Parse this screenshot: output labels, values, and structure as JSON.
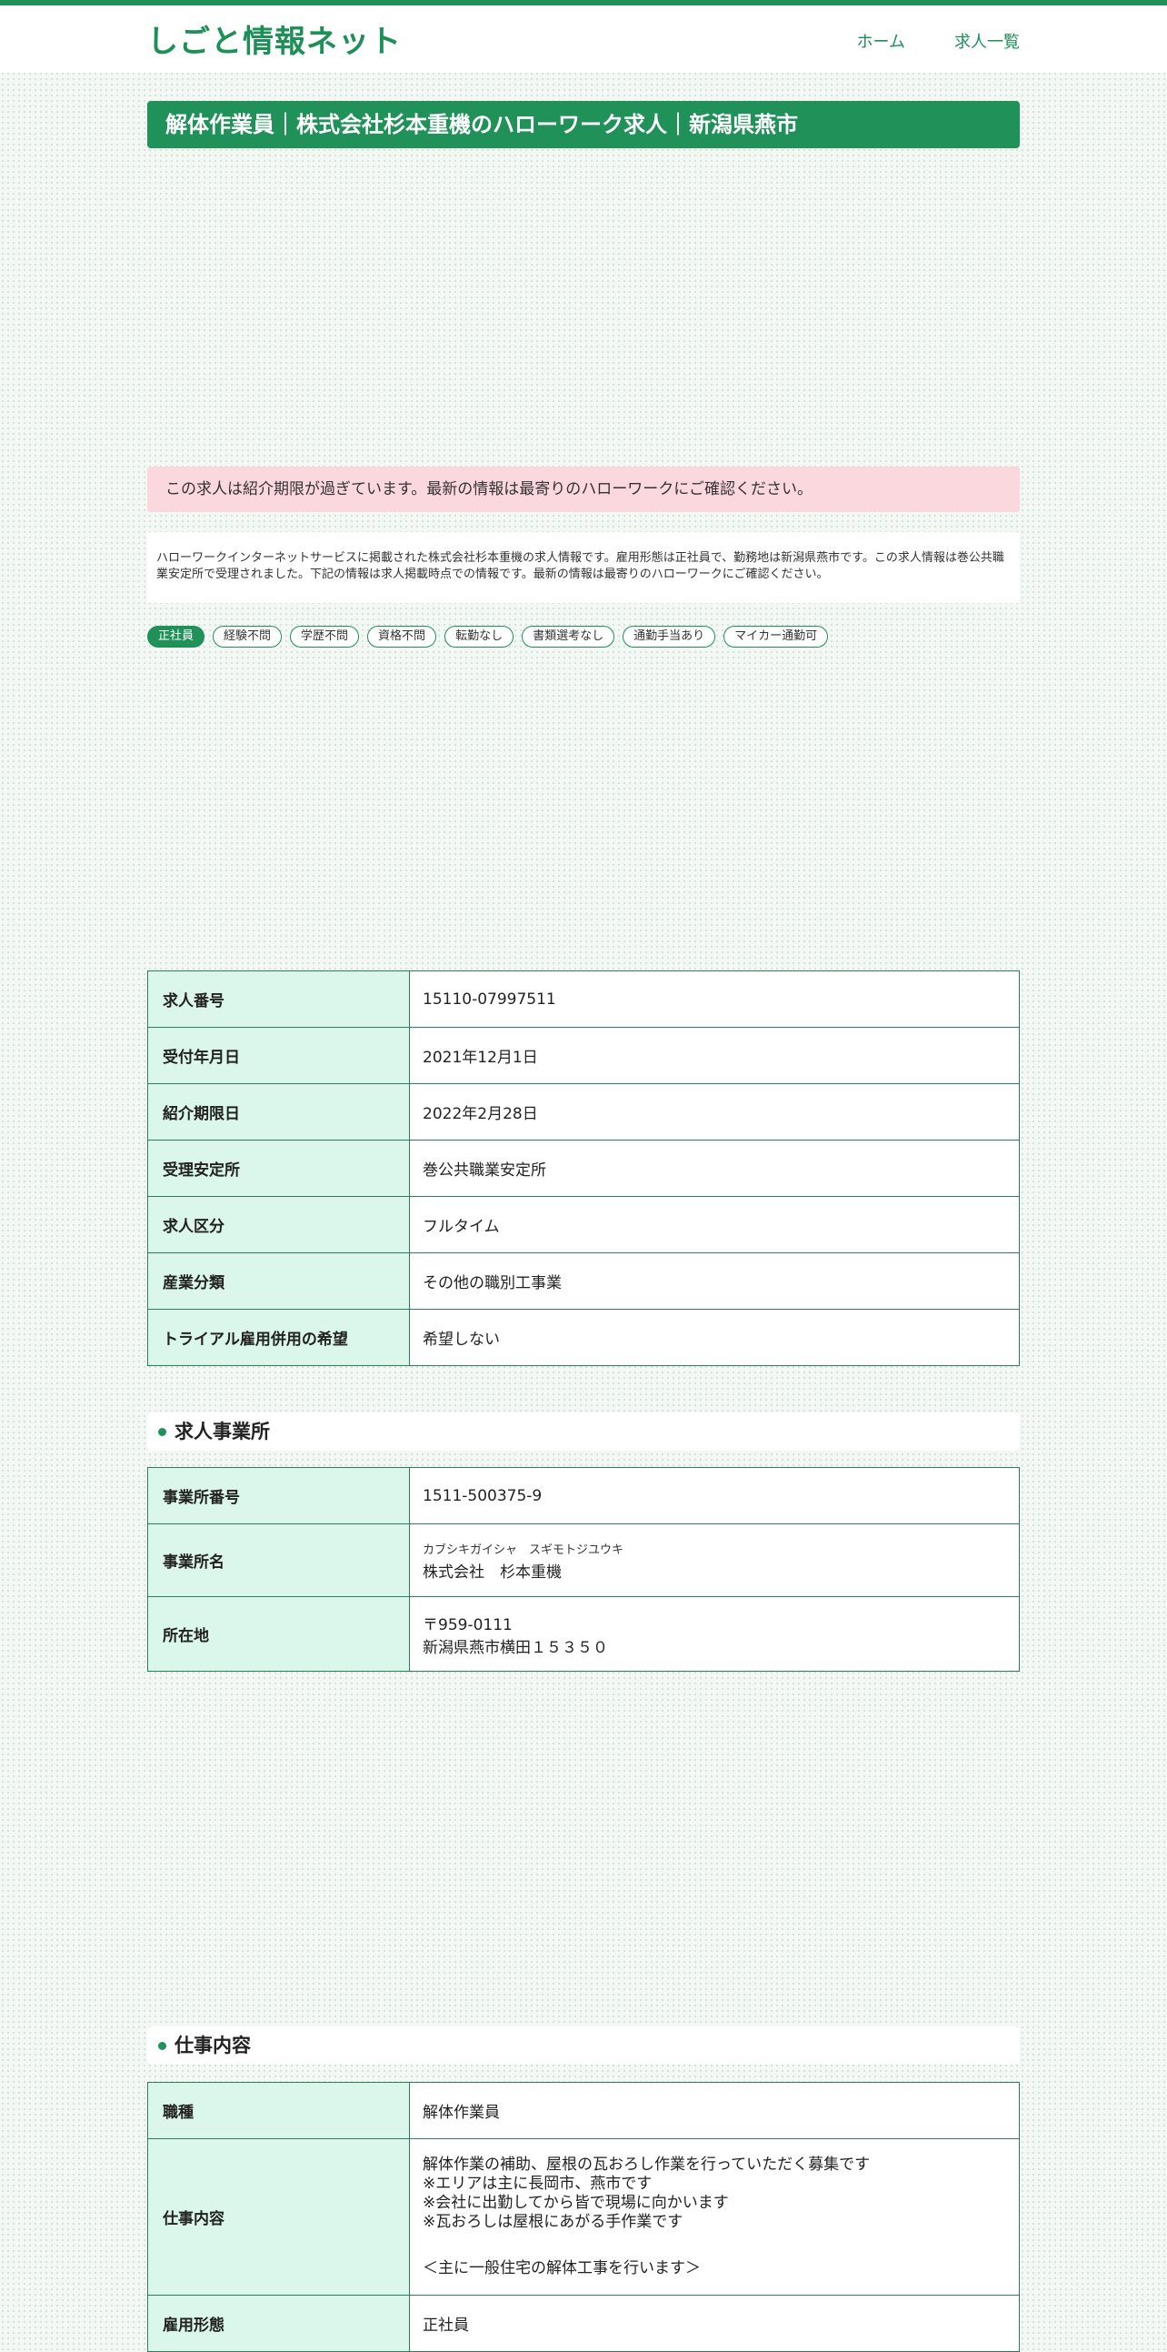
{
  "site": {
    "title": "しごと情報ネット",
    "nav": [
      "ホーム",
      "求人一覧"
    ]
  },
  "page_title": "解体作業員｜株式会社杉本重機のハローワーク求人｜新潟県燕市",
  "alert": "この求人は紹介期限が過ぎています。最新の情報は最寄りのハローワークにご確認ください。",
  "description": "ハローワークインターネットサービスに掲載された株式会社杉本重機の求人情報です。雇用形態は正社員で、勤務地は新潟県燕市です。この求人情報は巻公共職業安定所で受理されました。下記の情報は求人掲載時点での情報です。最新の情報は最寄りのハローワークにご確認ください。",
  "tags": [
    "正社員",
    "経験不問",
    "学歴不問",
    "資格不問",
    "転勤なし",
    "書類選考なし",
    "通勤手当あり",
    "マイカー通勤可"
  ],
  "basic_info": [
    {
      "key": "求人番号",
      "value": "15110-07997511"
    },
    {
      "key": "受付年月日",
      "value": "2021年12月1日"
    },
    {
      "key": "紹介期限日",
      "value": "2022年2月28日"
    },
    {
      "key": "受理安定所",
      "value": "巻公共職業安定所"
    },
    {
      "key": "求人区分",
      "value": "フルタイム"
    },
    {
      "key": "産業分類",
      "value": "その他の職別工事業"
    },
    {
      "key": "トライアル雇用併用の希望",
      "value": "希望しない"
    }
  ],
  "office": {
    "heading": "求人事業所",
    "number_key": "事業所番号",
    "number": "1511-500375-9",
    "name_key": "事業所名",
    "name_kana": "カブシキガイシャ　スギモトジユウキ",
    "name": "株式会社　杉本重機",
    "address_key": "所在地",
    "postal": "〒959-0111",
    "address": "新潟県燕市横田１５３５０"
  },
  "job": {
    "heading": "仕事内容",
    "title_key": "職種",
    "title": "解体作業員",
    "content_key": "仕事内容",
    "content_lines": [
      "解体作業の補助、屋根の瓦おろし作業を行っていただく募集です",
      "※エリアは主に長岡市、燕市です",
      "※会社に出勤してから皆で現場に向かいます",
      "※瓦おろしは屋根にあがる手作業です"
    ],
    "content_note": "＜主に一般住宅の解体工事を行います＞",
    "employment_key": "雇用形態",
    "employment": "正社員"
  }
}
